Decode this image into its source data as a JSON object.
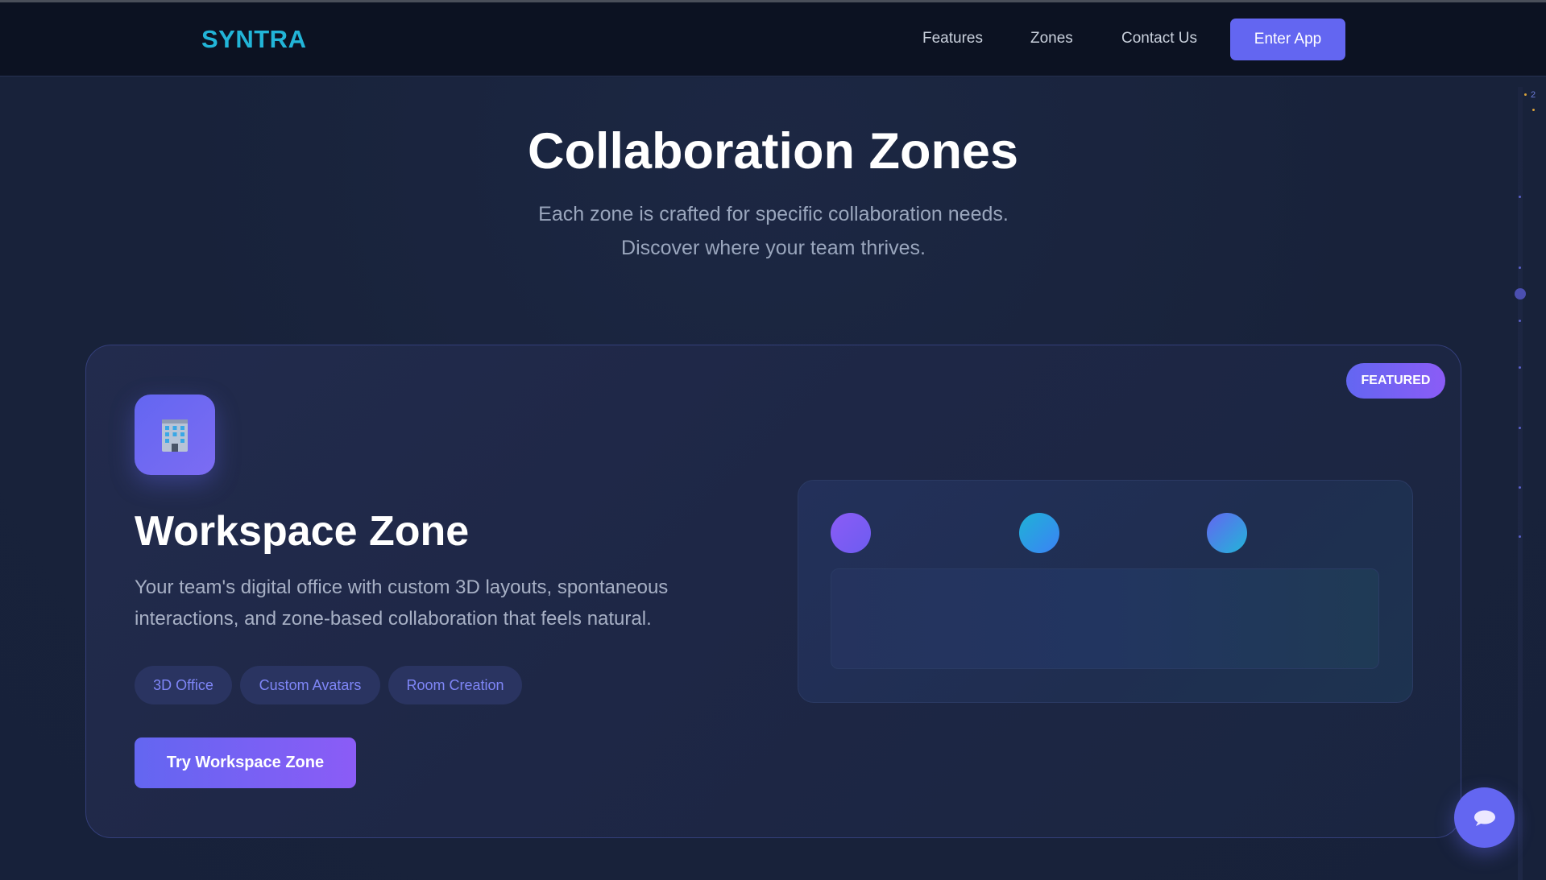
{
  "nav": {
    "logo": "SYNTRA",
    "links": [
      {
        "label": "Features"
      },
      {
        "label": "Zones"
      },
      {
        "label": "Contact Us"
      }
    ],
    "cta_label": "Enter App"
  },
  "hero": {
    "title": "Collaboration Zones",
    "subtitle_line1": "Each zone is crafted for specific collaboration needs.",
    "subtitle_line2": "Discover where your team thrives."
  },
  "zone_card": {
    "badge": "FEATURED",
    "icon": "office-building-icon",
    "title": "Workspace Zone",
    "description": "Your team's digital office with custom 3D layouts, spontaneous interactions, and zone-based collaboration that feels natural.",
    "tags": [
      {
        "label": "3D Office"
      },
      {
        "label": "Custom Avatars"
      },
      {
        "label": "Room Creation"
      }
    ],
    "button_label": "Try Workspace Zone"
  },
  "scrollbar": {
    "marker_label": "2"
  },
  "chat": {
    "icon": "chat-bubble-icon"
  },
  "colors": {
    "accent": "#6366f1",
    "accent_secondary": "#8b5cf6",
    "logo": "#22b5d8",
    "background": "#18223a"
  }
}
